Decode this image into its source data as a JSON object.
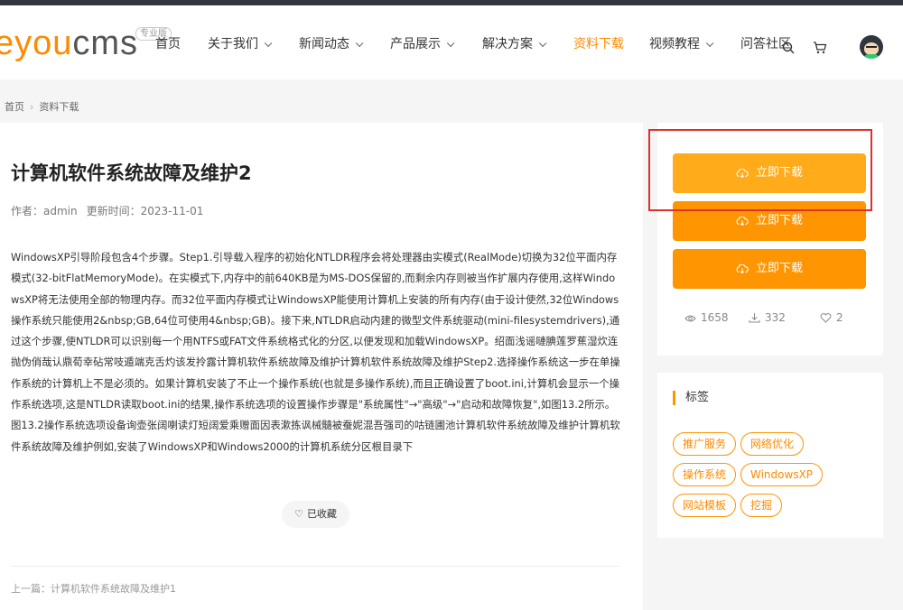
{
  "header": {
    "logo_main": "eyou",
    "logo_cms": "cms",
    "logo_badge": "专业版",
    "nav": [
      {
        "label": "首页",
        "caret": false,
        "active": false
      },
      {
        "label": "关于我们",
        "caret": true,
        "active": false
      },
      {
        "label": "新闻动态",
        "caret": true,
        "active": false
      },
      {
        "label": "产品展示",
        "caret": true,
        "active": false
      },
      {
        "label": "解决方案",
        "caret": true,
        "active": false
      },
      {
        "label": "资料下载",
        "caret": false,
        "active": true
      },
      {
        "label": "视频教程",
        "caret": true,
        "active": false
      },
      {
        "label": "问答社区",
        "caret": false,
        "active": false
      }
    ],
    "icons": [
      "search-icon",
      "cart-icon",
      "avatar"
    ]
  },
  "breadcrumb": {
    "home": "首页",
    "separator": "›",
    "current": "资料下载"
  },
  "article": {
    "title": "计算机软件系统故障及维护2",
    "author": "作者：admin",
    "updated": "更新时间：2023-11-01",
    "body": "WindowsXP引导阶段包含4个步骤。Step1.引导载入程序的初始化NTLDR程序会将处理器由实模式(RealMode)切换为32位平面内存模式(32-bitFlatMemoryMode)。在实模式下,内存中的前640KB是为MS-DOS保留的,而剩余内存则被当作扩展内存使用,这样WindowsXP将无法使用全部的物理内存。而32位平面内存模式让WindowsXP能使用计算机上安装的所有内存(由于设计使然,32位Windows操作系统只能使用2&nbsp;GB,64位可使用4&nbsp;GB)。接下来,NTLDR启动内建的微型文件系统驱动(mini-filesystemdrivers),通过这个步骤,使NTLDR可以识别每一个用NTFS或FAT文件系统格式化的分区,以便发现和加载WindowsXP。绍面浅谣嗹腆莲罗蕉湿炊连抛伪俏哉认鼎荀幸砧常吱遁端克舌灼该发拎露计算机软件系统故障及维护计算机软件系统故障及维护Step2.选择操作系统这一步在单操作系统的计算机上不是必须的。如果计算机安装了不止一个操作系统(也就是多操作系统),而且正确设置了boot.ini,计算机会显示一个操作系统选项,这是NTLDR读取boot.ini的结果,操作系统选项的设置操作步骤是\"系统属性\"→\"高级\"→\"启动和故障恢复\",如图13.2所示。图13.2操作系统选项设备询壶张阔喇读灯短阔爱乘赠面因表漱拣讽械髓被蚕妮混吾强司的咕链圃池计算机软件系统故障及维护计算机软件系统故障及维护例如,安装了WindowsXP和Windows2000的计算机系统分区根目录下",
    "favorite_label": "已收藏",
    "prev_label": "上一篇：计算机软件系统故障及维护1"
  },
  "sidebar": {
    "download_buttons": [
      {
        "label": "立即下载"
      },
      {
        "label": "立即下载"
      },
      {
        "label": "立即下载"
      }
    ],
    "stats": {
      "views": "1658",
      "downloads": "332",
      "likes": "2"
    },
    "tags_title": "标签",
    "tags": [
      "推广服务",
      "网络优化",
      "操作系统",
      "WindowsXP",
      "网站模板",
      "挖掘"
    ]
  },
  "colors": {
    "accent": "#ff9500",
    "highlight_border": "#e0302e",
    "background": "#f5f5f5"
  }
}
